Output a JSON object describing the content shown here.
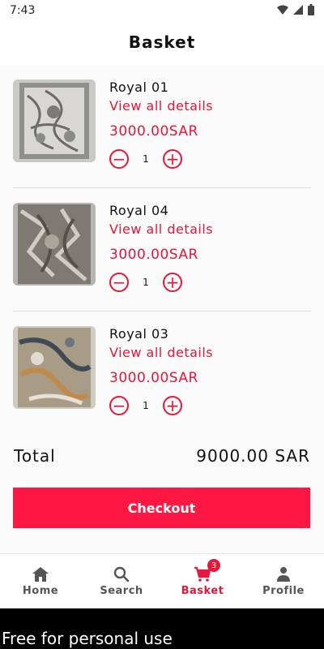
{
  "status": {
    "time": "7:43"
  },
  "header": {
    "title": "Basket"
  },
  "items": [
    {
      "name": "Royal 01",
      "details_label": "View all details",
      "price": "3000.00SAR",
      "quantity": "1"
    },
    {
      "name": "Royal 04",
      "details_label": "View all details",
      "price": "3000.00SAR",
      "quantity": "1"
    },
    {
      "name": "Royal 03",
      "details_label": "View all details",
      "price": "3000.00SAR",
      "quantity": "1"
    }
  ],
  "summary": {
    "total_label": "Total",
    "total_value": "9000.00 SAR"
  },
  "checkout_label": "Checkout",
  "nav": {
    "items": [
      {
        "label": "Home",
        "icon": "home-icon"
      },
      {
        "label": "Search",
        "icon": "search-icon"
      },
      {
        "label": "Basket",
        "icon": "cart-icon",
        "badge": "3"
      },
      {
        "label": "Profile",
        "icon": "person-icon"
      }
    ]
  },
  "watermark": "Free for personal use",
  "colors": {
    "accent": "#e8163b",
    "button": "#ff1744"
  }
}
